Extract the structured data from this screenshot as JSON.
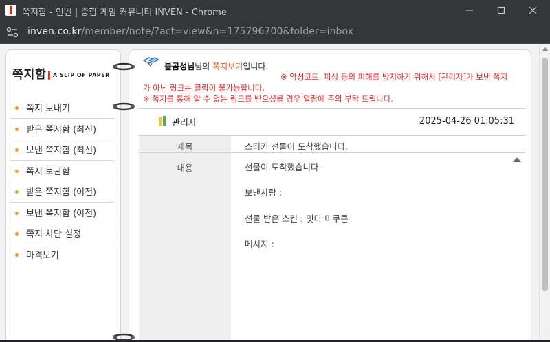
{
  "window": {
    "title": "쪽지함 - 인벤 | 종합 게임 커뮤니티 INVEN - Chrome",
    "url_host": "inven.co.kr",
    "url_rest": "/member/note/?act=view&n=175796700&folder=inbox"
  },
  "sidebar": {
    "logo_kr": "쪽지함",
    "logo_en": "A SLIP OF PAPER",
    "items": [
      {
        "label": "쪽지 보내기"
      },
      {
        "label": "받은 쪽지함 (최신)"
      },
      {
        "label": "보낸 쪽지함 (최신)"
      },
      {
        "label": "쪽지 보관함"
      },
      {
        "label": "받은 쪽지함 (이전)"
      },
      {
        "label": "보낸 쪽지함 (이전)"
      },
      {
        "label": "쪽지 차단 설정"
      },
      {
        "label": "마격보기"
      }
    ]
  },
  "message": {
    "user_name": "불곰성님",
    "header_mid": "님의 ",
    "header_hl": "쪽지보기",
    "header_end": "입니다.",
    "warning1a": "※ 악성코드, 피싱 등의 피해를 방지하기 위해서 [관리자]가 보낸 쪽지",
    "warning1b": "가 아닌 링크는 클릭이 불가능합니다.",
    "warning2": "※ 쪽지를 통해 알 수 없는 링크를 받으셨을 경우 열람에 주의 부탁 드립니다.",
    "sender": "관리자",
    "date": "2025-04-26 01:05:31",
    "subject_label": "제목",
    "subject": "스티커 선물이 도착했습니다.",
    "content_label": "내용",
    "body_lines": [
      "선물이 도착했습니다.",
      "보낸사람 :",
      "선물 받은 스킨 : 밋다 미쿠콘",
      "메시지 :"
    ]
  },
  "colors": {
    "accent_orange": "#e05a1d",
    "warning_red": "#e02a2a",
    "bullet": "#f2a122"
  }
}
